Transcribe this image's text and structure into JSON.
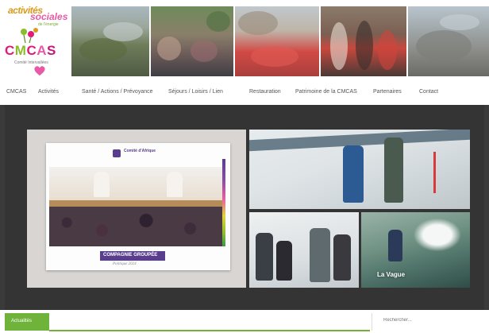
{
  "logo": {
    "line1": "activités",
    "line2": "sociales",
    "line3": "de l'énergie",
    "acronym": [
      "C",
      "M",
      "C",
      "A",
      "S"
    ],
    "tagline": "Comité Intervallées"
  },
  "nav": {
    "items": [
      "CMCAS",
      "Activités",
      "Santé / Actions / Prévoyance",
      "Séjours / Loisirs / Lien",
      "Restauration",
      "Patrimoine de la CMCAS",
      "Partenaires",
      "Contact"
    ]
  },
  "slider": {
    "card_title": "Comité d'Afrique",
    "card_ribbon": "COMPAGNIE GROUPÉE",
    "card_subtitle": "Politique 2024",
    "tile2_caption": "",
    "tile3_caption": "",
    "tile4_caption": "La Vague"
  },
  "bottom": {
    "news_tab": "Actualités",
    "search_placeholder": "Rechercher..."
  },
  "colors": {
    "accent_green": "#6fb33b",
    "brand_pink": "#e3197a",
    "brand_purple": "#5a3e8e",
    "slider_bg": "#3a3a3a"
  },
  "icons": [
    "logo-flowers-icon",
    "logo-heart-icon",
    "crest-icon"
  ]
}
